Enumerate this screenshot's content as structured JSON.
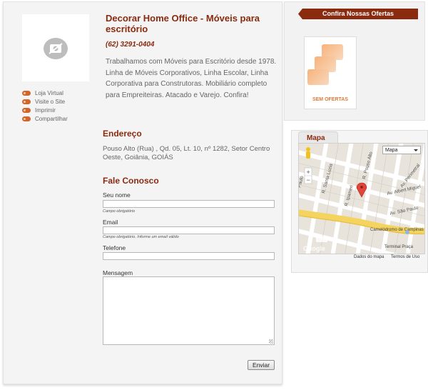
{
  "company": {
    "name": "Decorar Home Office - Móveis para escritório",
    "phone": "(62) 3291-0404",
    "description": "Trabalhamos com Móveis para Escritório desde 1978. Linha de Móveis Corporativos, Linha Escolar, Linha Corporativa para Construtoras. Mobiliário completo para Empreiteiras. Atacado e Varejo. Confira!"
  },
  "side_links": [
    "Loja Virtual",
    "Visite o Site",
    "Imprimir",
    "Compartilhar"
  ],
  "address": {
    "title": "Endereço",
    "text": "Pouso Alto (Rua) , Qd. 05, Lt. 10, nº 1282, Setor Centro Oeste, Goiânia, GOIÁS"
  },
  "contact": {
    "title": "Fale Conosco",
    "name_label": "Seu nome",
    "name_hint": "Campo obrigatório",
    "email_label": "Email",
    "email_hint": "Campo obrigatório. Informe um email válido",
    "phone_label": "Telefone",
    "message_label": "Mensagem",
    "send_label": "Enviar"
  },
  "offers": {
    "ribbon": "Confira Nossas Ofertas",
    "empty_label": "SEM OFERTAS"
  },
  "map": {
    "tab": "Mapa",
    "type_select": "Mapa",
    "streets": [
      "R. Pouso Alto",
      "R. Santa Luzia",
      "R. Ipameri",
      "Av. Perimetral",
      "Av. Albert Miguel",
      "Av. São Paulo",
      "Paulo"
    ],
    "places": [
      "Camelódromo de Campinas",
      "Terminal Praça"
    ],
    "footer_data": "Dados do mapa",
    "footer_terms": "Termos de Uso",
    "zoom_in": "+",
    "zoom_out": "−"
  },
  "colors": {
    "brand": "#8a2a0e",
    "accent": "#d0662b",
    "highway": "#f4d35e"
  }
}
